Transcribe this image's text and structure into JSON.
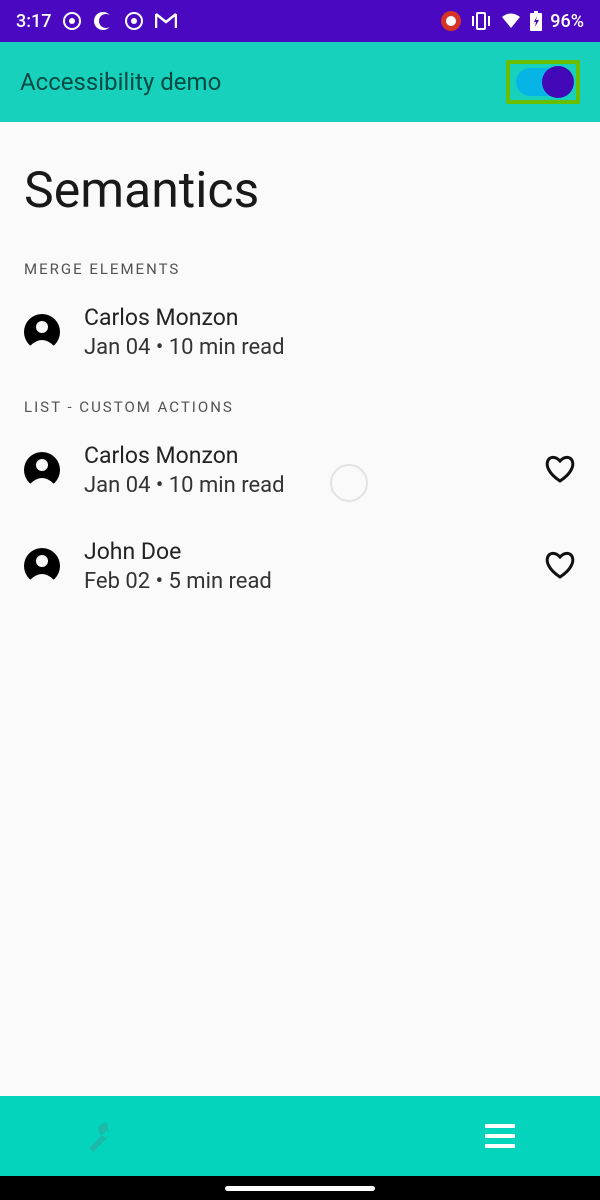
{
  "status": {
    "time": "3:17",
    "battery": "96%"
  },
  "appBar": {
    "title": "Accessibility demo"
  },
  "page": {
    "title": "Semantics"
  },
  "sections": {
    "merge": {
      "label": "MERGE ELEMENTS",
      "author": "Carlos Monzon",
      "meta": "Jan 04 • 10 min read"
    },
    "list": {
      "label": "LIST - CUSTOM ACTIONS",
      "items": [
        {
          "author": "Carlos Monzon",
          "meta": "Jan 04 • 10 min read"
        },
        {
          "author": "John Doe",
          "meta": "Feb 02 • 5 min read"
        }
      ]
    }
  }
}
